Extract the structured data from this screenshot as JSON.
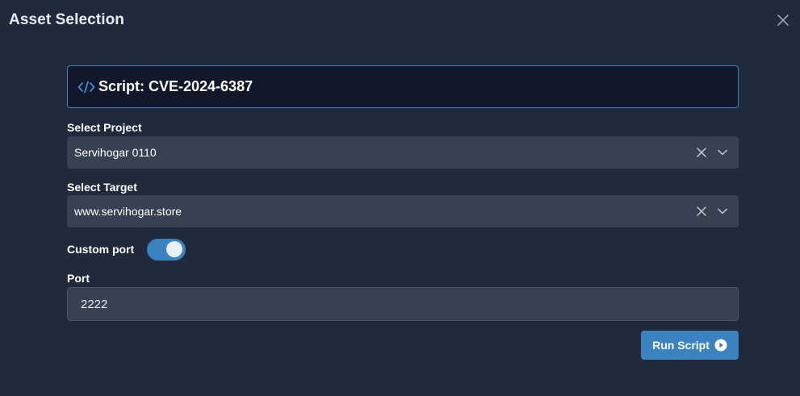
{
  "modal": {
    "title": "Asset Selection"
  },
  "script": {
    "title": "Script: CVE-2024-6387"
  },
  "project": {
    "label": "Select Project",
    "value": "Servihogar 0110"
  },
  "target": {
    "label": "Select Target",
    "value": "www.servihogar.store"
  },
  "custom_port": {
    "label": "Custom port",
    "enabled": true
  },
  "port": {
    "label": "Port",
    "value": "2222"
  },
  "actions": {
    "run_label": "Run Script"
  },
  "icons": {
    "close": "close-icon",
    "code": "code-icon",
    "clear": "clear-icon",
    "chevron": "chevron-down-icon",
    "play": "play-circle-icon"
  },
  "colors": {
    "background": "#212a3a",
    "accent": "#3b82c0",
    "field": "#374152",
    "header_bg": "#121829"
  }
}
